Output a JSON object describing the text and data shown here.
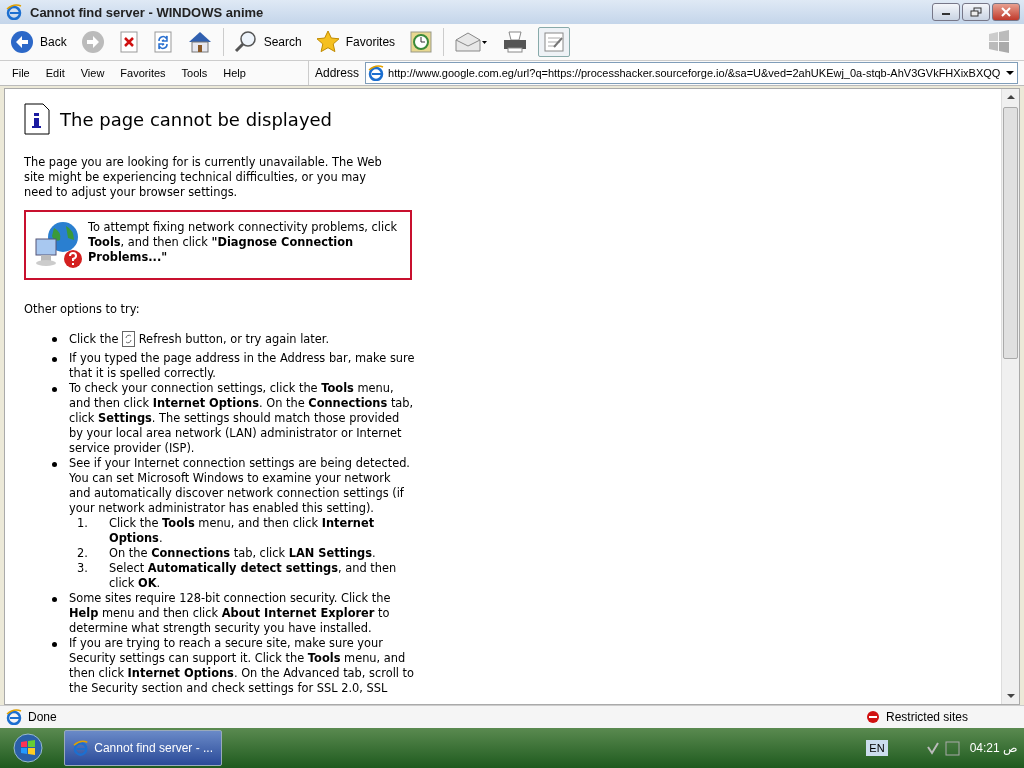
{
  "window": {
    "title": "Cannot find server - WINDOWS anime"
  },
  "toolbar": {
    "buttons": [
      {
        "kind": "back",
        "label": "Back"
      },
      {
        "kind": "forward"
      },
      {
        "kind": "stop"
      },
      {
        "kind": "refresh"
      },
      {
        "kind": "home"
      },
      {
        "kind": "search",
        "label": "Search"
      },
      {
        "kind": "favorites",
        "label": "Favorites"
      },
      {
        "kind": "history"
      },
      {
        "kind": "mail"
      },
      {
        "kind": "print"
      },
      {
        "kind": "edit"
      }
    ]
  },
  "menu": [
    "File",
    "Edit",
    "View",
    "Favorites",
    "Tools",
    "Help"
  ],
  "address": {
    "label": "Address",
    "value": "http://www.google.com.eg/url?q=https://processhacker.sourceforge.io/&sa=U&ved=2ahUKEwj_0a-stqb-AhV3GVkFHXixBXQQ"
  },
  "page": {
    "heading": "The page cannot be displayed",
    "intro": "The page you are looking for is currently unavailable. The Web site might be experiencing technical difficulties, or you may need to adjust your browser settings.",
    "tip": "To attempt fixing network connectivity problems, click **Tools**, and then click **\"Diagnose Connection Problems...\"**",
    "options_heading": "Other options to try:",
    "bullets": [
      {
        "kind": "refresh",
        "before": "Click the",
        "after": "Refresh button, or try again later."
      },
      {
        "kind": "text",
        "text": "If you typed the page address in the Address bar, make sure that it is spelled correctly."
      },
      {
        "kind": "text",
        "text": "To check your connection settings, click the **Tools** menu, and then click **Internet Options**. On the **Connections** tab, click **Settings**. The settings should match those provided by your local area network (LAN) administrator or Internet service provider (ISP)."
      },
      {
        "kind": "text",
        "text": "See if your Internet connection settings are being detected. You can set Microsoft Windows to examine your network and automatically discover network connection settings (if your network administrator has enabled this setting).",
        "steps": [
          {
            "number": "1.",
            "text": "Click the **Tools** menu, and then click **Internet Options**."
          },
          {
            "number": "2.",
            "text": "On the **Connections** tab, click **LAN Settings**."
          },
          {
            "number": "3.",
            "text": "Select **Automatically detect settings**, and then click **OK**."
          }
        ]
      },
      {
        "kind": "text",
        "text": "Some sites require 128-bit connection security. Click the **Help** menu and then click **About Internet Explorer** to determine what strength security you have installed."
      },
      {
        "kind": "text",
        "text": "If you are trying to reach a secure site, make sure your Security settings can support it. Click the **Tools** menu, and then click **Internet Options**. On the Advanced tab, scroll to the Security section and check settings for SSL 2.0, SSL"
      }
    ]
  },
  "status_bar": {
    "text": "Done",
    "zone": "Restricted sites"
  },
  "taskbar": {
    "task": "Cannot find server - ...",
    "language": "EN",
    "clock": "04:21 ص"
  }
}
